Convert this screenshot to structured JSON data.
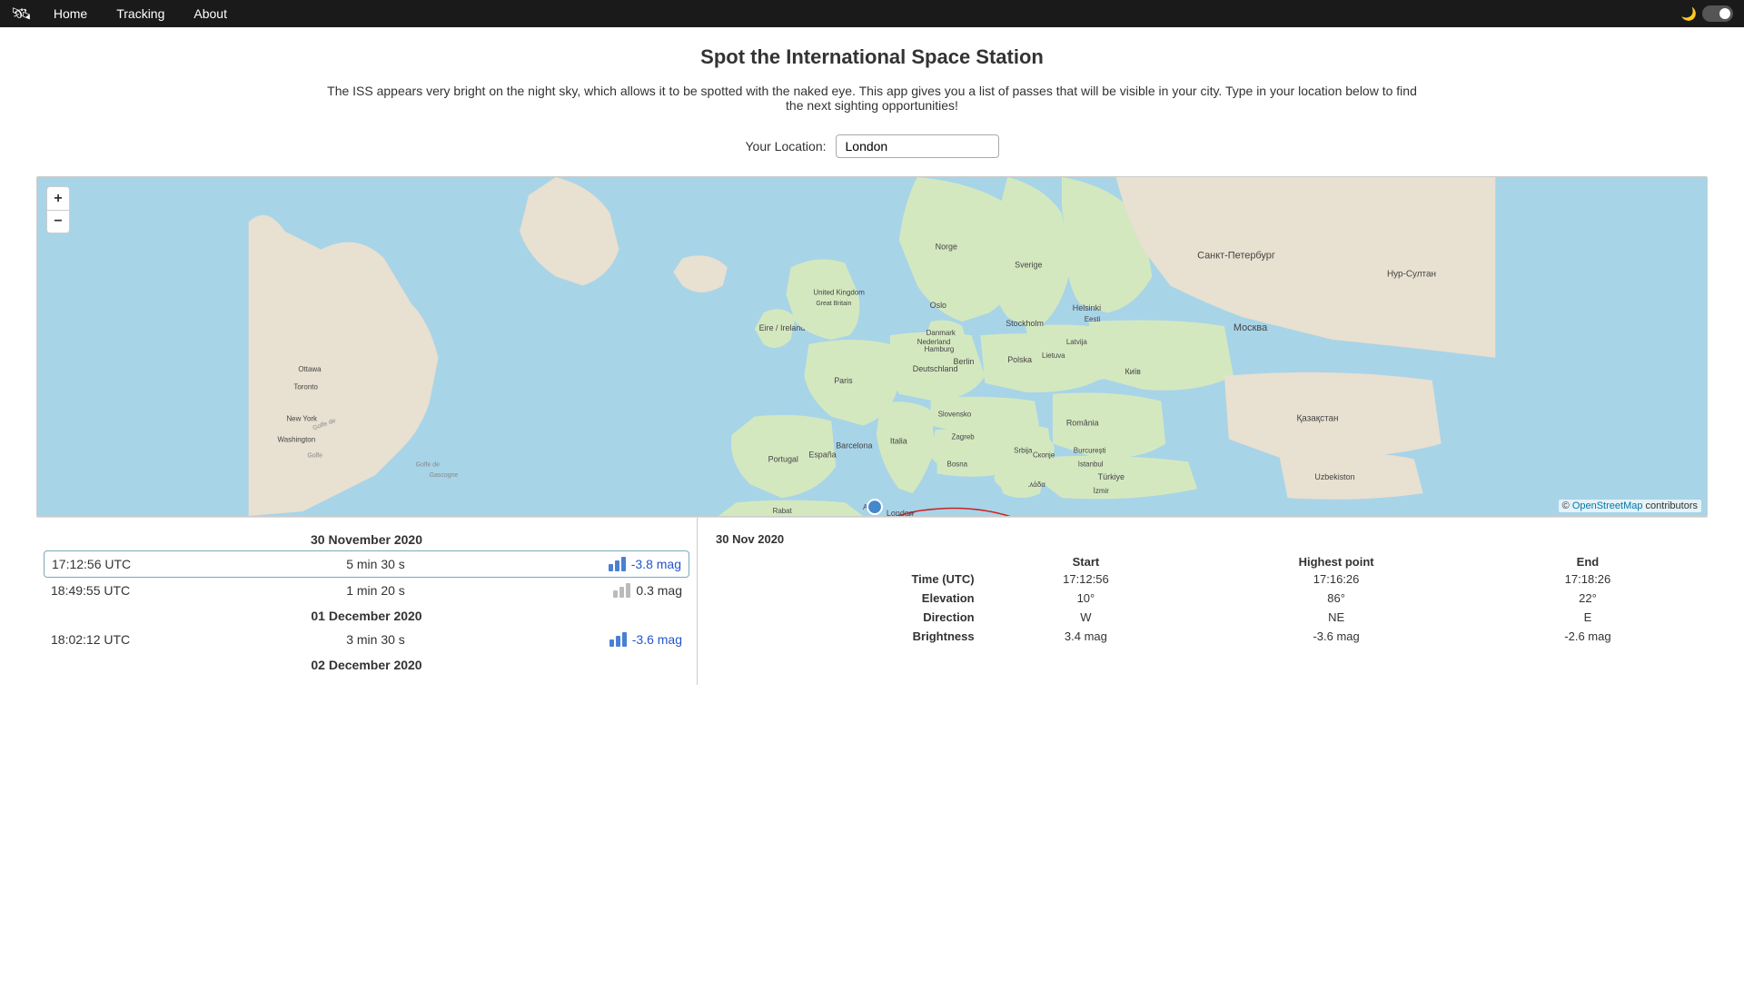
{
  "nav": {
    "logo": "🛰",
    "items": [
      {
        "id": "home",
        "label": "Home",
        "active": true
      },
      {
        "id": "tracking",
        "label": "Tracking",
        "active": false
      },
      {
        "id": "about",
        "label": "About",
        "active": false
      }
    ],
    "dark_toggle_label": "🌙"
  },
  "page": {
    "title": "Spot the International Space Station",
    "subtitle": "The ISS appears very bright on the night sky, which allows it to be spotted with the naked eye. This app gives you a list of passes that will be visible in your city. Type in your location below to find the next sighting opportunities!",
    "location_label": "Your Location:",
    "location_value": "London"
  },
  "map": {
    "osm_credit": "© OpenStreetMap contributors"
  },
  "passes": {
    "groups": [
      {
        "date": "30 November 2020",
        "rows": [
          {
            "time": "17:12:56 UTC",
            "duration": "5 min 30 s",
            "brightness": "-3.8 mag",
            "bright_level": 3,
            "selected": true,
            "color": "blue"
          },
          {
            "time": "18:49:55 UTC",
            "duration": "1 min 20 s",
            "brightness": "0.3 mag",
            "bright_level": 1,
            "selected": false,
            "color": "gray"
          }
        ]
      },
      {
        "date": "01 December 2020",
        "rows": [
          {
            "time": "18:02:12 UTC",
            "duration": "3 min 30 s",
            "brightness": "-3.6 mag",
            "bright_level": 3,
            "selected": false,
            "color": "blue"
          }
        ]
      },
      {
        "date": "02 December 2020",
        "rows": []
      }
    ]
  },
  "detail": {
    "date": "30 Nov 2020",
    "columns": [
      "Start",
      "Highest point",
      "End"
    ],
    "rows": [
      {
        "label": "Time (UTC)",
        "values": [
          "17:12:56",
          "17:16:26",
          "17:18:26"
        ]
      },
      {
        "label": "Elevation",
        "values": [
          "10°",
          "86°",
          "22°"
        ]
      },
      {
        "label": "Direction",
        "values": [
          "W",
          "NE",
          "E"
        ]
      },
      {
        "label": "Brightness",
        "values": [
          "3.4 mag",
          "-3.6 mag",
          "-2.6 mag"
        ]
      }
    ]
  }
}
